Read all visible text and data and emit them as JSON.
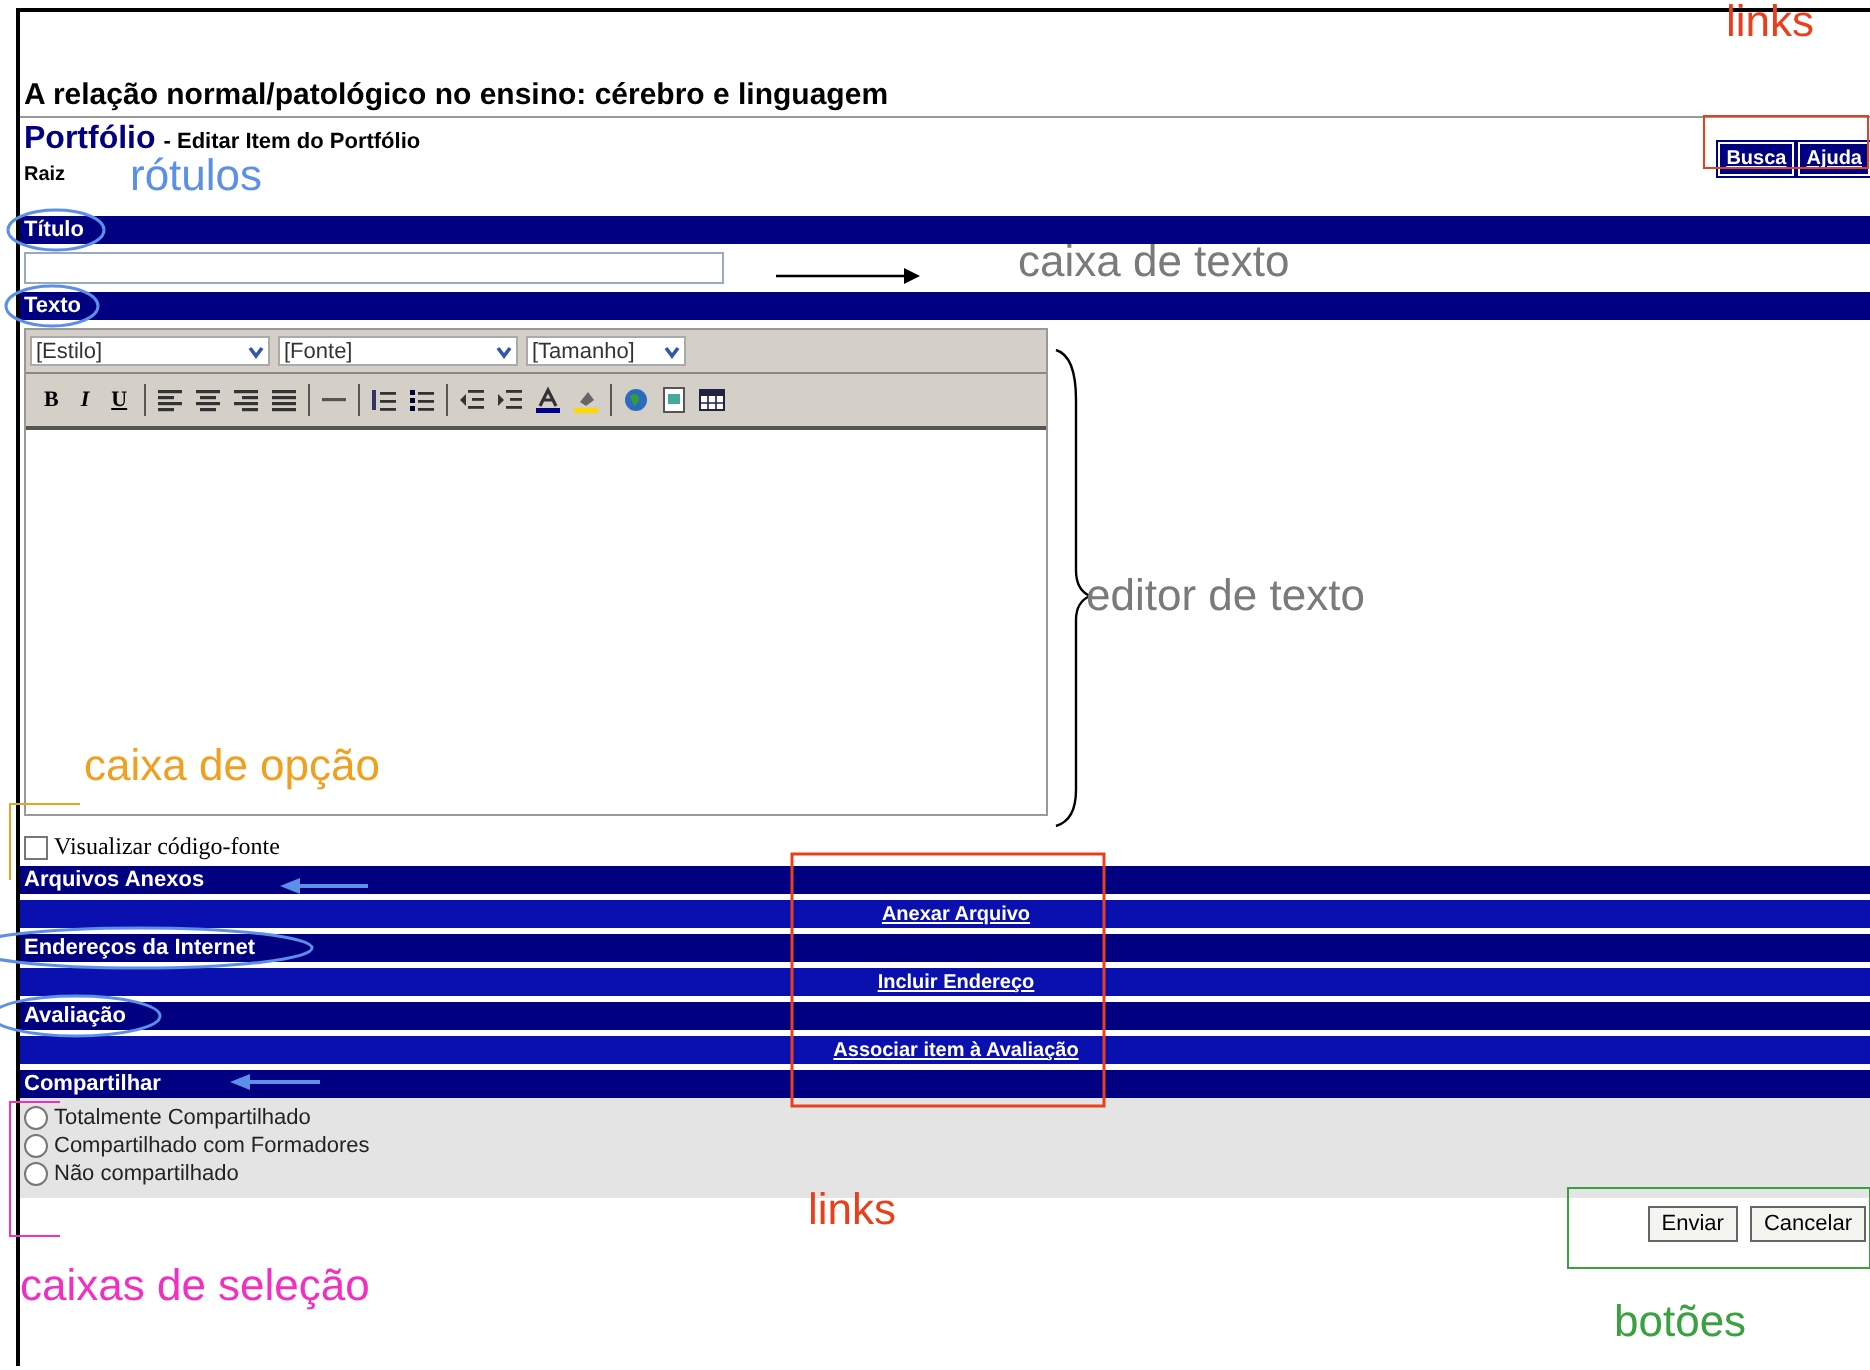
{
  "page_title": "A relação normal/patológico no ensino: cérebro e linguagem",
  "header": {
    "tool": "Portfólio",
    "subtitle": "- Editar Item do Portfólio",
    "breadcrumb": "Raiz"
  },
  "top_links": [
    {
      "label": "Busca"
    },
    {
      "label": "Ajuda"
    }
  ],
  "title_field": {
    "label": "Título"
  },
  "text_editor": {
    "label": "Texto",
    "dropdowns": [
      "[Estilo]",
      "[Fonte]",
      "[Tamanho]"
    ],
    "format_buttons": [
      "B",
      "I",
      "U"
    ]
  },
  "source_view": {
    "label": "Visualizar código-fonte",
    "checked": false
  },
  "sections": [
    {
      "label": "Arquivos Anexos",
      "link": "Anexar Arquivo"
    },
    {
      "label": "Endereços da Internet",
      "link": "Incluir Endereço"
    },
    {
      "label": "Avaliação",
      "link": "Associar item à Avaliação"
    }
  ],
  "share": {
    "label": "Compartilhar",
    "options": [
      {
        "label": "Totalmente Compartilhado",
        "selected": false
      },
      {
        "label": "Compartilhado com Formadores",
        "selected": false
      },
      {
        "label": "Não compartilhado",
        "selected": false
      }
    ]
  },
  "buttons": [
    "Enviar",
    "Cancelar"
  ],
  "annotations": [
    {
      "text": "links",
      "color": "#e8401c"
    },
    {
      "text": "rótulos",
      "color": "#5b8fe8"
    },
    {
      "text": "caixa de texto",
      "color": "#7a7a7a"
    },
    {
      "text": "editor de texto",
      "color": "#7a7a7a"
    },
    {
      "text": "caixa de opção",
      "color": "#f0a020"
    },
    {
      "text": "links",
      "color": "#e8401c"
    },
    {
      "text": "caixas de seleção",
      "color": "#f030c0"
    },
    {
      "text": "botões",
      "color": "#3aa040"
    }
  ]
}
